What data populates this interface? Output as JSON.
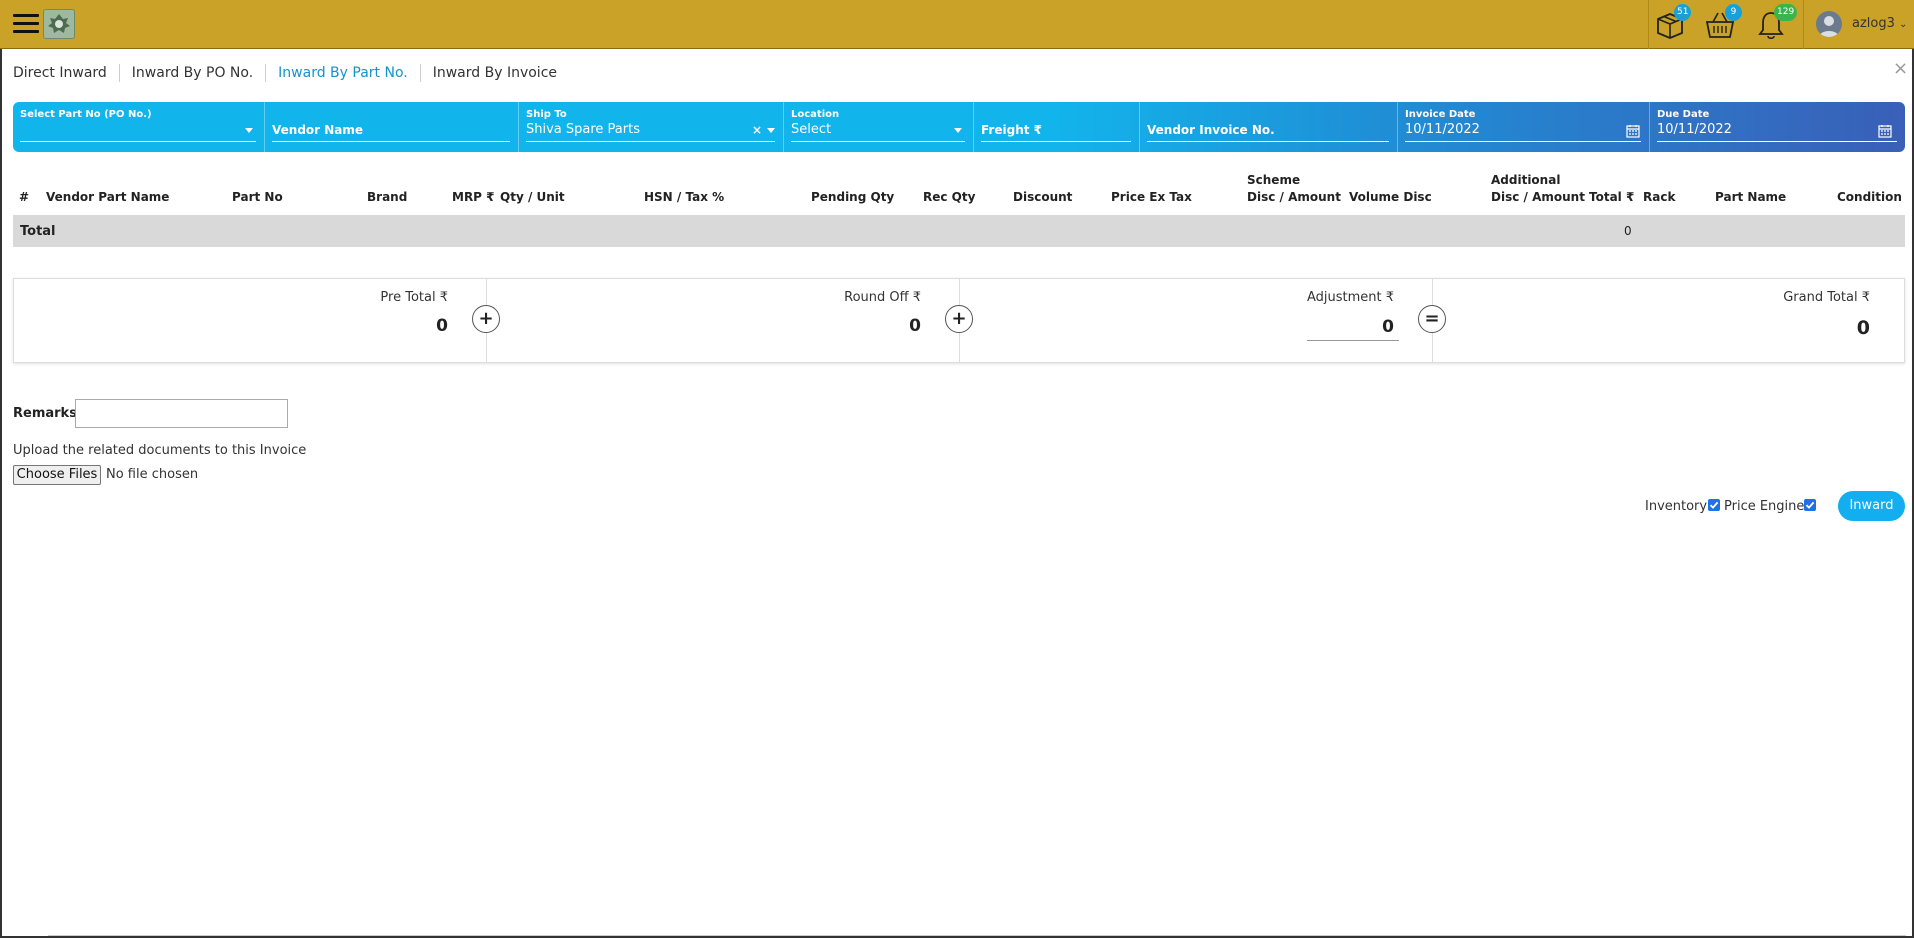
{
  "topbar": {
    "badges": {
      "box": "51",
      "basket": "9",
      "bell": "129"
    },
    "username": "azlog3"
  },
  "tabs": [
    {
      "label": "Direct Inward"
    },
    {
      "label": "Inward By PO No."
    },
    {
      "label": "Inward By Part No."
    },
    {
      "label": "Inward By Invoice"
    }
  ],
  "filters": {
    "part_no": {
      "label": "Select Part No (PO No.)",
      "value": ""
    },
    "vendor_name": {
      "placeholder": "Vendor Name"
    },
    "ship_to": {
      "label": "Ship To",
      "value": "Shiva Spare Parts"
    },
    "location": {
      "label": "Location",
      "value": "Select"
    },
    "freight": {
      "placeholder": "Freight ₹"
    },
    "vendor_invoice": {
      "placeholder": "Vendor Invoice No."
    },
    "invoice_date": {
      "label": "Invoice Date",
      "value": "10/11/2022"
    },
    "due_date": {
      "label": "Due Date",
      "value": "10/11/2022"
    }
  },
  "table": {
    "headers": {
      "idx": "#",
      "vendor_part_name": "Vendor Part Name",
      "part_no": "Part No",
      "brand": "Brand",
      "mrp": "MRP ₹",
      "qty_unit": "Qty / Unit",
      "hsn_tax": "HSN / Tax %",
      "pending_qty": "Pending Qty",
      "rec_qty": "Rec Qty",
      "discount": "Discount",
      "price_ex_tax": "Price Ex Tax",
      "scheme_l1": "Scheme",
      "scheme_l2": "Disc / Amount",
      "volume_disc": "Volume Disc",
      "additional_l1": "Additional",
      "additional_l2": "Disc / Amount",
      "total": "Total ₹",
      "rack": "Rack",
      "part_name": "Part Name",
      "condition": "Condition"
    },
    "total_label": "Total",
    "total_value": "0"
  },
  "summary": {
    "pre_total": {
      "label": "Pre Total ₹",
      "value": "0"
    },
    "round_off": {
      "label": "Round Off ₹",
      "value": "0"
    },
    "adjustment": {
      "label": "Adjustment ₹",
      "value": "0"
    },
    "grand_total": {
      "label": "Grand Total ₹",
      "value": "0"
    },
    "op_plus": "+",
    "op_equals": "="
  },
  "remarks": {
    "label": "Remarks",
    "value": ""
  },
  "upload": {
    "label": "Upload the related documents to this Invoice",
    "button": "Choose Files",
    "status": "No file chosen"
  },
  "options": {
    "inventory_label": "Inventory",
    "inventory_checked": true,
    "price_engine_label": "Price Engine",
    "price_engine_checked": true
  },
  "actions": {
    "inward_label": "Inward"
  },
  "colors": {
    "topbar": "#c9a227",
    "accent": "#12b4ec",
    "active_tab": "#1593c9"
  }
}
